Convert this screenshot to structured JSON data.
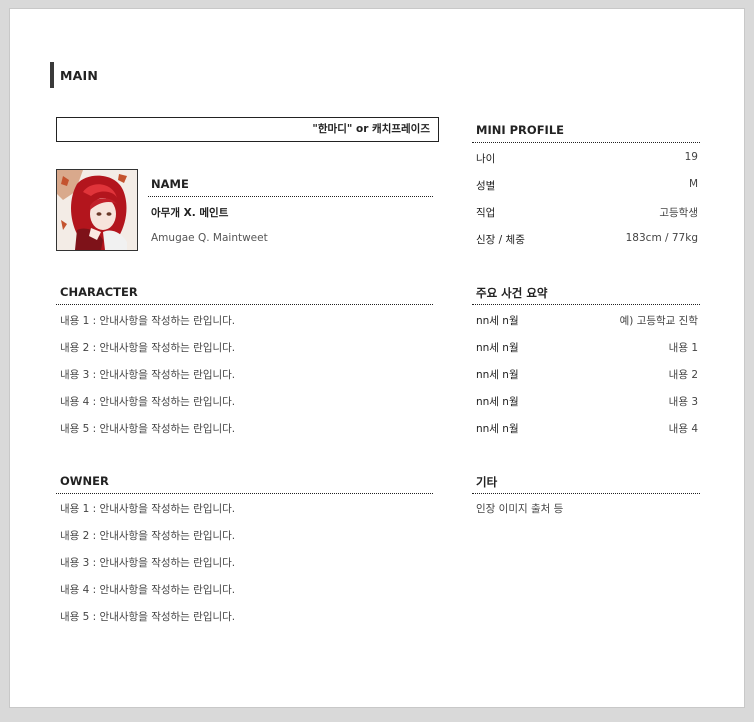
{
  "main": {
    "title": "MAIN"
  },
  "catchphrase": "\"한마디\" or 캐치프레이즈",
  "name_section": {
    "heading": "NAME",
    "korean_name": "아무개 X. 메인트",
    "english_name": "Amugae Q. Maintweet"
  },
  "mini_profile": {
    "heading": "MINI PROFILE",
    "rows": [
      {
        "label": "나이",
        "value": "19"
      },
      {
        "label": "성별",
        "value": "M"
      },
      {
        "label": "직업",
        "value": "고등학생"
      },
      {
        "label": "신장 / 체중",
        "value": "183cm / 77kg"
      }
    ]
  },
  "character": {
    "heading": "CHARACTER",
    "items": [
      "내용 1 : 안내사항을 작성하는 란입니다.",
      "내용 2 : 안내사항을 작성하는 란입니다.",
      "내용 3 : 안내사항을 작성하는 란입니다.",
      "내용 4 : 안내사항을 작성하는 란입니다.",
      "내용 5 : 안내사항을 작성하는 란입니다."
    ]
  },
  "events": {
    "heading": "주요 사건 요약",
    "rows": [
      {
        "label": "nn세 n월",
        "value": "예) 고등학교 진학"
      },
      {
        "label": "nn세 n월",
        "value": "내용 1"
      },
      {
        "label": "nn세 n월",
        "value": "내용 2"
      },
      {
        "label": "nn세 n월",
        "value": "내용 3"
      },
      {
        "label": "nn세 n월",
        "value": "내용 4"
      }
    ]
  },
  "owner": {
    "heading": "OWNER",
    "items": [
      "내용 1 : 안내사항을 작성하는 란입니다.",
      "내용 2 : 안내사항을 작성하는 란입니다.",
      "내용 3 : 안내사항을 작성하는 란입니다.",
      "내용 4 : 안내사항을 작성하는 란입니다.",
      "내용 5 : 안내사항을 작성하는 란입니다."
    ]
  },
  "etc": {
    "heading": "기타",
    "text": "인장 이미지 출처 등"
  },
  "colors": {
    "page_bg": "#ffffff",
    "frame_bg": "#d9d9d9",
    "accent_bar": "#3a3a3a",
    "text": "#444444"
  }
}
